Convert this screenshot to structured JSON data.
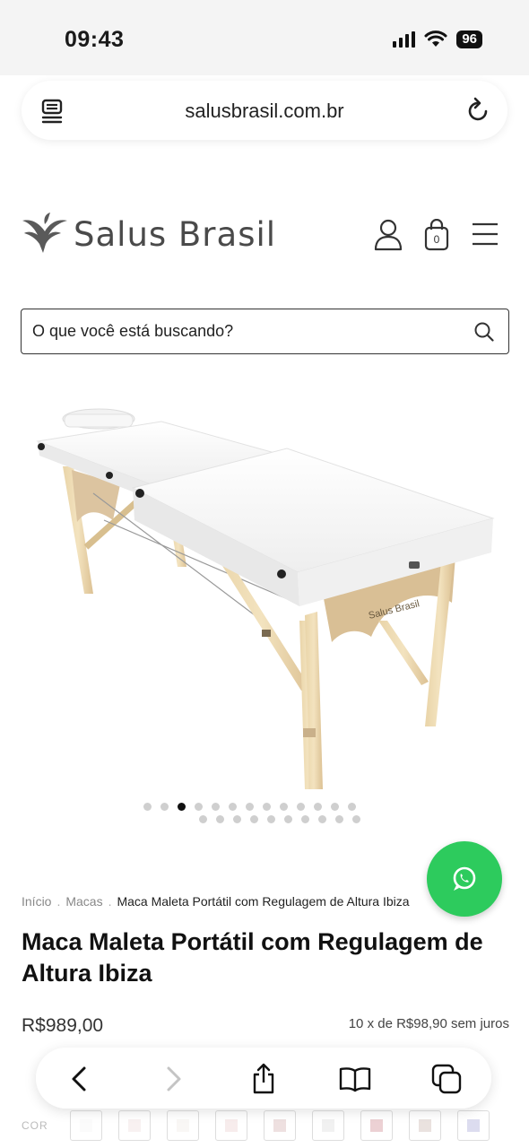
{
  "status_bar": {
    "time": "09:43",
    "battery": "96",
    "icons": [
      "signal-icon",
      "wifi-icon",
      "battery-icon"
    ]
  },
  "browser": {
    "url": "salusbrasil.com.br",
    "icons": [
      "reader-icon",
      "reload-icon"
    ]
  },
  "header": {
    "logo_text": "Salus Brasil",
    "cart_count": "0",
    "icons": [
      "user-icon",
      "cart-icon",
      "menu-icon"
    ]
  },
  "search": {
    "placeholder": "O que você está buscando?"
  },
  "gallery": {
    "total_images": 23,
    "active_index": 2,
    "image_brand_text": "Salus Brasil"
  },
  "breadcrumb": {
    "home": "Início",
    "category": "Macas",
    "current": "Maca Maleta Portátil com Regulagem de Altura Ibiza"
  },
  "product": {
    "title": "Maca Maleta Portátil com Regulagem de Altura Ibiza",
    "price": "R$989,00",
    "installments": "10 x de R$98,90 sem juros"
  },
  "color": {
    "label": "COR",
    "swatches": [
      "#f3f3f3",
      "#ead8d6",
      "#efe7e3",
      "#e8c9c8",
      "#cfa6a6",
      "#d8d8d8",
      "#c97b84",
      "#c4ada2",
      "#9a9ad0"
    ]
  },
  "accent_colors": {
    "whatsapp": "#2dcb5d"
  }
}
